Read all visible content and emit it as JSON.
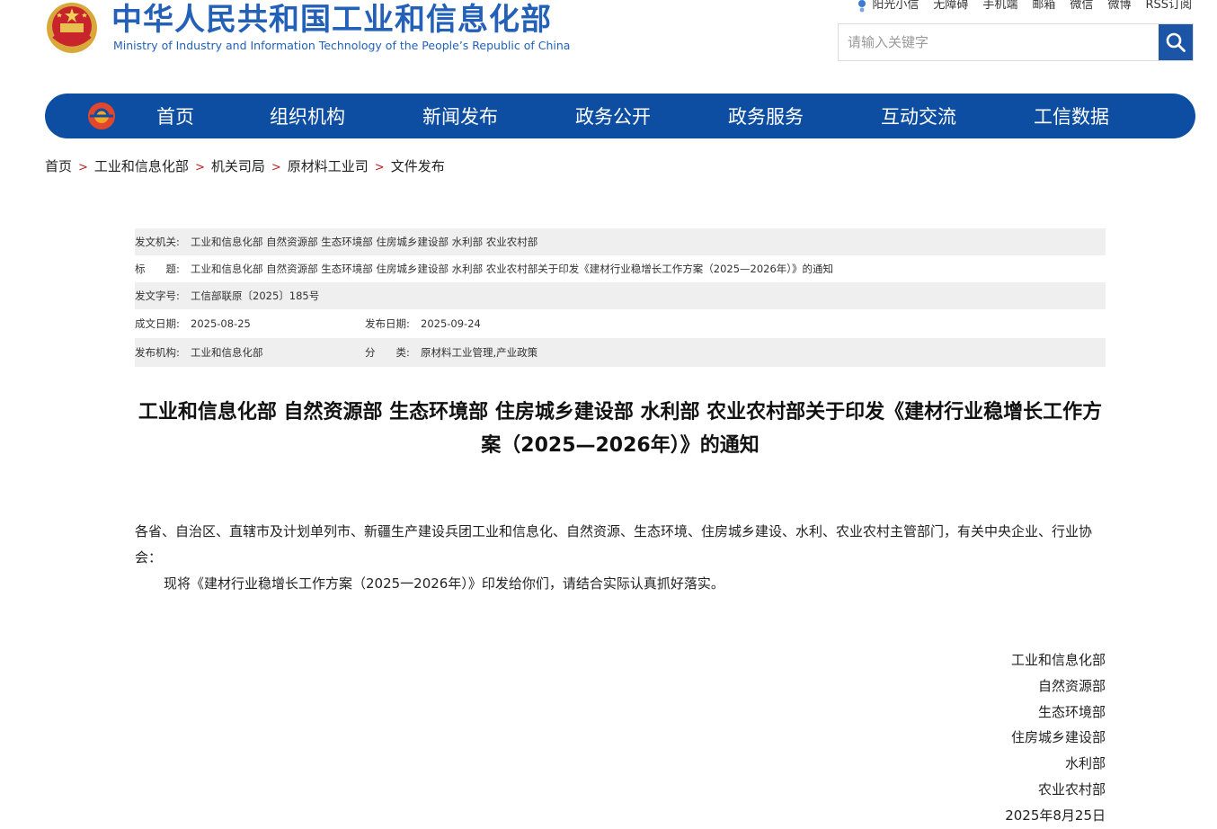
{
  "header": {
    "site_title": "中华人民共和国工业和信息化部",
    "site_subtitle": "Ministry of Industry and Information Technology of the People’s Republic of China",
    "top_links": [
      "阳光小信",
      "无障碍",
      "手机端",
      "邮箱",
      "微信",
      "微博",
      "RSS订阅"
    ],
    "search_placeholder": "请输入关键字",
    "brand_color": "#2361b8"
  },
  "nav": {
    "items": [
      "首页",
      "组织机构",
      "新闻发布",
      "政务公开",
      "政务服务",
      "互动交流",
      "工信数据"
    ],
    "bg_color": "#0d4ea3"
  },
  "breadcrumb": [
    "首页",
    "工业和信息化部",
    "机关司局",
    "原材料工业司",
    "文件发布"
  ],
  "meta": {
    "issuer_label": "发文机关:",
    "issuer": "工业和信息化部 自然资源部 生态环境部 住房城乡建设部 水利部 农业农村部",
    "title_label": "标　　题:",
    "title": "工业和信息化部 自然资源部 生态环境部 住房城乡建设部 水利部 农业农村部关于印发《建材行业稳增长工作方案（2025—2026年）》的通知",
    "docno_label": "发文字号:",
    "docno": "工信部联原〔2025〕185号",
    "created_label": "成文日期:",
    "created": "2025-08-25",
    "published_label": "发布日期:",
    "published": "2025-09-24",
    "org_label": "发布机构:",
    "org": "工业和信息化部",
    "category_label": "分　　类:",
    "category": "原材料工业管理,产业政策"
  },
  "article": {
    "title": "工业和信息化部 自然资源部 生态环境部 住房城乡建设部 水利部 农业农村部关于印发《建材行业稳增长工作方案（2025—2026年）》的通知",
    "salutation": "各省、自治区、直辖市及计划单列市、新疆生产建设兵团工业和信息化、自然资源、生态环境、住房城乡建设、水利、农业农村主管部门，有关中央企业、行业协会：",
    "body": "现将《建材行业稳增长工作方案（2025一2026年）》印发给你们，请结合实际认真抓好落实。",
    "signatories": [
      "工业和信息化部",
      "自然资源部",
      "生态环境部",
      "住房城乡建设部",
      "水利部",
      "农业农村部"
    ],
    "date": "2025年8月25日"
  }
}
